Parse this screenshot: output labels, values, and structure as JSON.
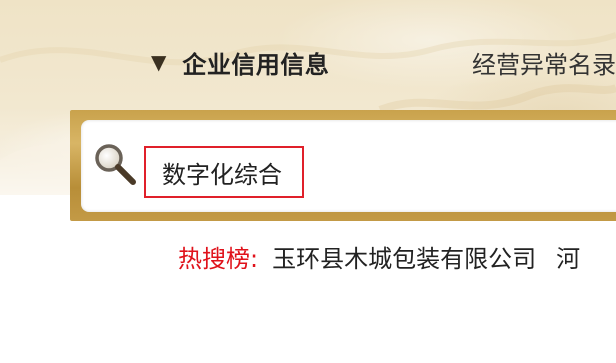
{
  "tabs": {
    "active_label": "企业信用信息",
    "next_label": "经营异常名录"
  },
  "search": {
    "value": "数字化综合"
  },
  "hot_search": {
    "label": "热搜榜:",
    "items": [
      "玉环县木城包装有限公司",
      "河"
    ]
  },
  "colors": {
    "accent_gold": "#c9a24c",
    "highlight_red": "#e0202a",
    "hot_label_red": "#e0121b"
  },
  "icons": {
    "search": "search-icon",
    "tab_indicator": "triangle-down-icon"
  }
}
